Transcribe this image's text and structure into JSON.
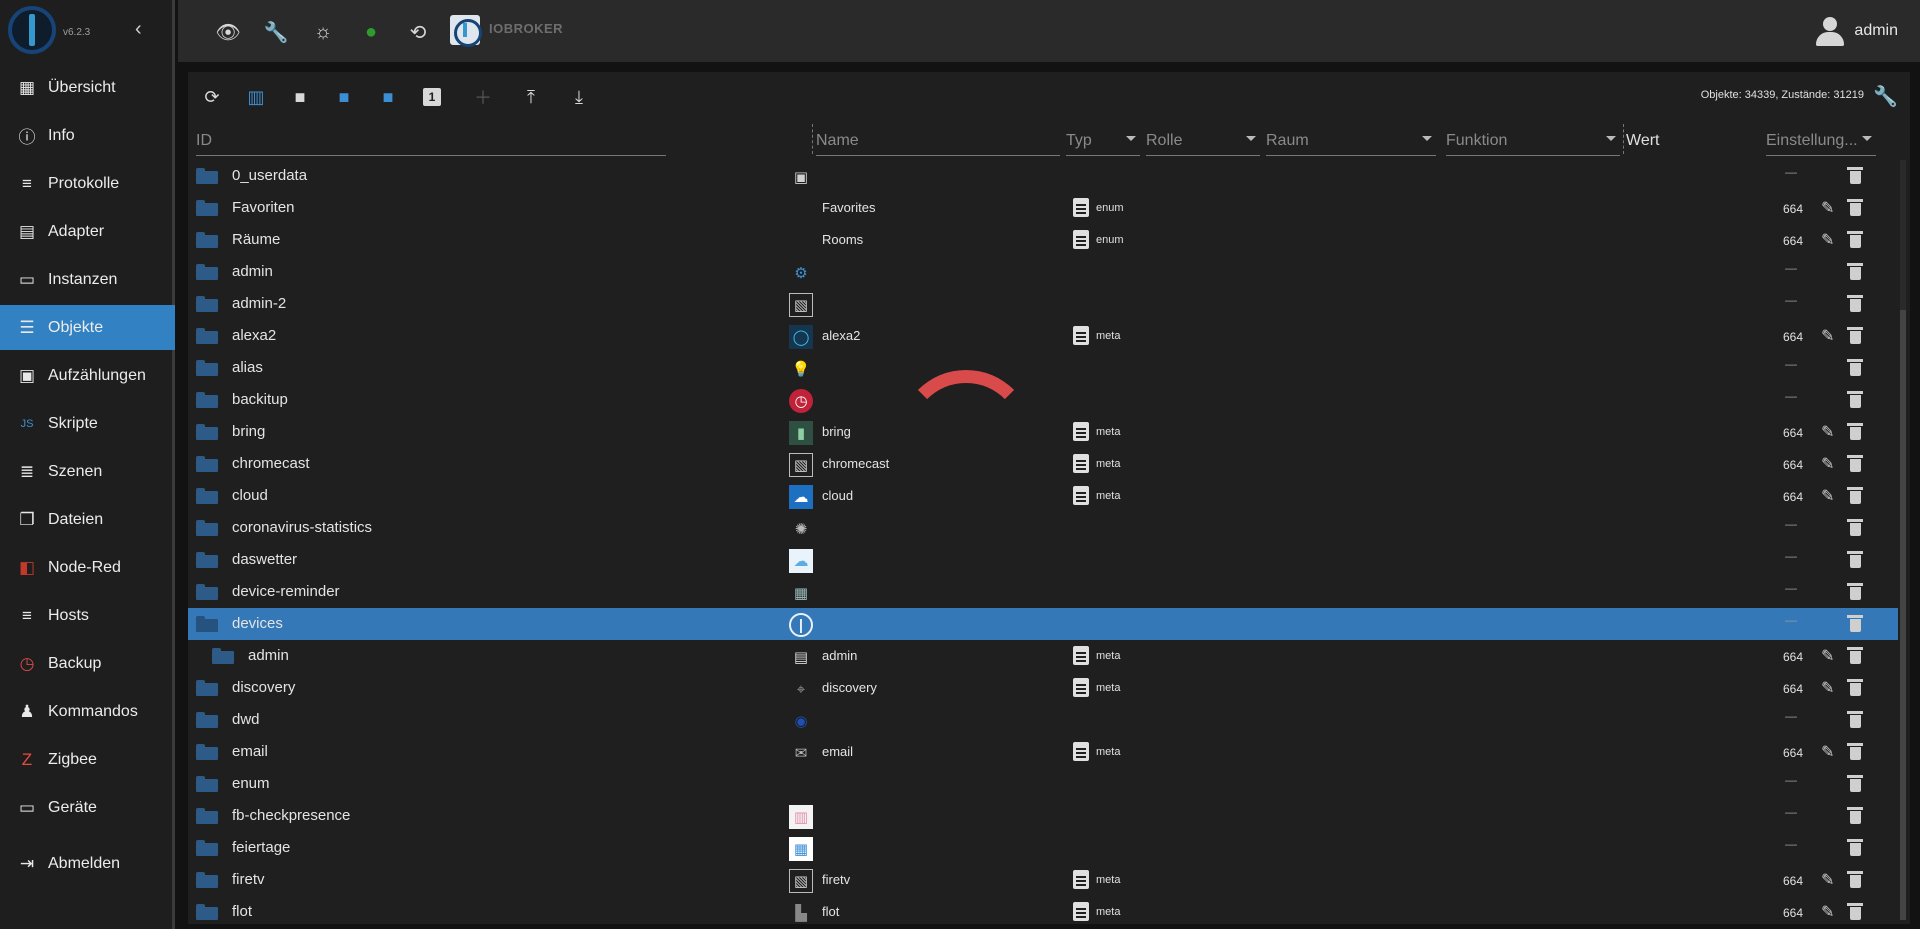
{
  "sidebar": {
    "version": "v6.2.3",
    "items": [
      {
        "label": "Übersicht",
        "icon": "grid-icon"
      },
      {
        "label": "Info",
        "icon": "info-icon"
      },
      {
        "label": "Protokolle",
        "icon": "list-icon"
      },
      {
        "label": "Adapter",
        "icon": "store-icon"
      },
      {
        "label": "Instanzen",
        "icon": "instances-icon"
      },
      {
        "label": "Objekte",
        "icon": "objects-icon",
        "active": true
      },
      {
        "label": "Aufzählungen",
        "icon": "enums-icon"
      },
      {
        "label": "Skripte",
        "icon": "js-icon"
      },
      {
        "label": "Szenen",
        "icon": "scenes-icon"
      },
      {
        "label": "Dateien",
        "icon": "files-icon"
      },
      {
        "label": "Node-Red",
        "icon": "nodered-icon"
      },
      {
        "label": "Hosts",
        "icon": "hosts-icon"
      },
      {
        "label": "Backup",
        "icon": "backup-icon"
      },
      {
        "label": "Kommandos",
        "icon": "commands-icon"
      },
      {
        "label": "Zigbee",
        "icon": "zigbee-icon"
      },
      {
        "label": "Geräte",
        "icon": "devices-icon"
      }
    ],
    "logout": "Abmelden"
  },
  "topbar": {
    "brand_text": "IOBROKER",
    "user": "admin"
  },
  "toolbar": {
    "stats": "Objekte: 34339, Zustände: 31219",
    "page_badge": "1"
  },
  "columns": {
    "id": "ID",
    "name": "Name",
    "typ": "Typ",
    "rolle": "Rolle",
    "raum": "Raum",
    "funktion": "Funktion",
    "wert": "Wert",
    "einstellung": "Einstellung..."
  },
  "colors": {
    "accent": "#3282c3",
    "selected_row": "#3478b7",
    "folder": "#2d5a86",
    "spinner": "#d94a4a"
  },
  "rows": [
    {
      "id": "0_userdata",
      "name": "",
      "type": "",
      "icon": "image-icon",
      "acl": ""
    },
    {
      "id": "Favoriten",
      "name": "Favorites",
      "type": "enum",
      "icon": "",
      "acl": "664"
    },
    {
      "id": "Räume",
      "name": "Rooms",
      "type": "enum",
      "icon": "",
      "acl": "664"
    },
    {
      "id": "admin",
      "name": "",
      "type": "",
      "icon": "admin-gear-icon",
      "acl": ""
    },
    {
      "id": "admin-2",
      "name": "",
      "type": "",
      "icon": "broken-image-icon",
      "acl": ""
    },
    {
      "id": "alexa2",
      "name": "alexa2",
      "type": "meta",
      "icon": "alexa-icon",
      "acl": "664"
    },
    {
      "id": "alias",
      "name": "",
      "type": "",
      "icon": "bulb-icon",
      "acl": ""
    },
    {
      "id": "backitup",
      "name": "",
      "type": "",
      "icon": "backitup-icon",
      "acl": ""
    },
    {
      "id": "bring",
      "name": "bring",
      "type": "meta",
      "icon": "bring-icon",
      "acl": "664"
    },
    {
      "id": "chromecast",
      "name": "chromecast",
      "type": "meta",
      "icon": "broken-image-icon",
      "acl": "664"
    },
    {
      "id": "cloud",
      "name": "cloud",
      "type": "meta",
      "icon": "cloud-icon",
      "acl": "664"
    },
    {
      "id": "coronavirus-statistics",
      "name": "",
      "type": "",
      "icon": "virus-icon",
      "acl": ""
    },
    {
      "id": "daswetter",
      "name": "",
      "type": "",
      "icon": "weather-icon",
      "acl": ""
    },
    {
      "id": "device-reminder",
      "name": "",
      "type": "",
      "icon": "reminder-icon",
      "acl": ""
    },
    {
      "id": "devices",
      "name": "",
      "type": "",
      "icon": "iobroker-icon",
      "acl": "",
      "selected": true,
      "open": true
    },
    {
      "id": "admin",
      "name": "admin",
      "type": "meta",
      "icon": "file-icon",
      "acl": "664",
      "child": true
    },
    {
      "id": "discovery",
      "name": "discovery",
      "type": "meta",
      "icon": "discovery-icon",
      "acl": "664"
    },
    {
      "id": "dwd",
      "name": "",
      "type": "",
      "icon": "dwd-icon",
      "acl": ""
    },
    {
      "id": "email",
      "name": "email",
      "type": "meta",
      "icon": "mail-icon",
      "acl": "664"
    },
    {
      "id": "enum",
      "name": "",
      "type": "",
      "icon": "",
      "acl": ""
    },
    {
      "id": "fb-checkpresence",
      "name": "",
      "type": "",
      "icon": "presence-icon",
      "acl": ""
    },
    {
      "id": "feiertage",
      "name": "",
      "type": "",
      "icon": "calendar-icon",
      "acl": ""
    },
    {
      "id": "firetv",
      "name": "firetv",
      "type": "meta",
      "icon": "broken-image-icon",
      "acl": "664"
    },
    {
      "id": "flot",
      "name": "flot",
      "type": "meta",
      "icon": "flot-icon",
      "acl": "664"
    }
  ]
}
